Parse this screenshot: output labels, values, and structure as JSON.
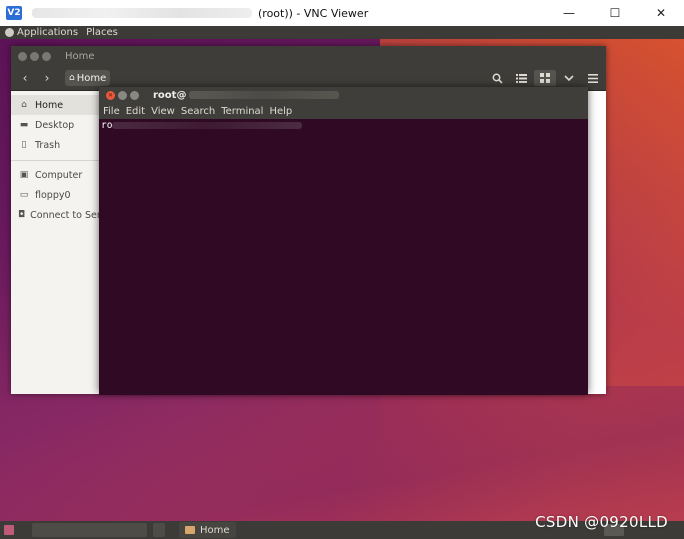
{
  "vnc": {
    "logo": "V2",
    "title_suffix": "(root)) - VNC Viewer",
    "minimize": "—",
    "maximize": "☐",
    "close": "✕"
  },
  "top_panel": {
    "applications": "Applications",
    "places": "Places"
  },
  "files": {
    "title": "Home",
    "back": "‹",
    "forward": "›",
    "path_label": "Home",
    "sidebar": [
      {
        "icon": "home-icon",
        "label": "Home"
      },
      {
        "icon": "folder-icon",
        "label": "Desktop"
      },
      {
        "icon": "trash-icon",
        "label": "Trash"
      },
      {
        "icon": "computer-icon",
        "label": "Computer"
      },
      {
        "icon": "drive-icon",
        "label": "floppy0"
      },
      {
        "icon": "network-icon",
        "label": "Connect to Server"
      }
    ]
  },
  "terminal": {
    "title_prefix": "root@",
    "menu": [
      "File",
      "Edit",
      "View",
      "Search",
      "Terminal",
      "Help"
    ],
    "prompt_prefix": "ro"
  },
  "taskbar": {
    "home_task": "Home"
  },
  "watermark": "CSDN @0920LLD"
}
